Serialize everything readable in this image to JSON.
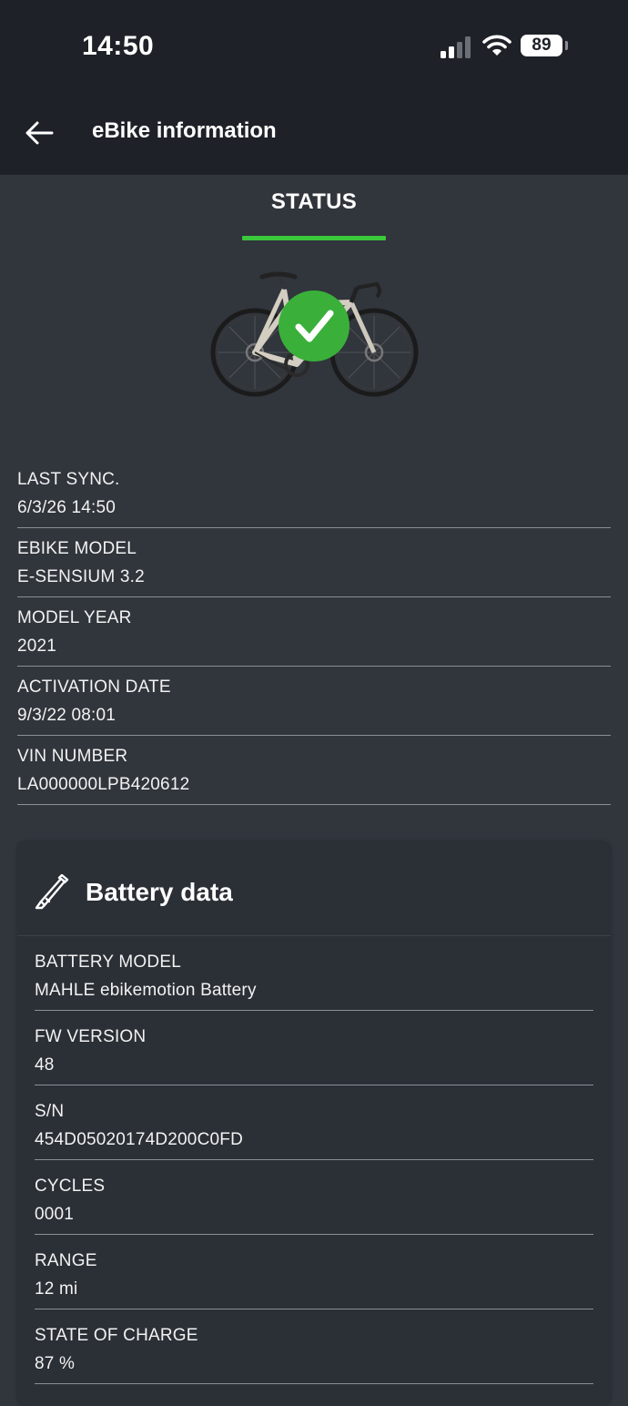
{
  "status_bar": {
    "time": "14:50",
    "battery_level": "89",
    "icons": [
      "cellular-signal-icon",
      "wifi-icon",
      "battery-icon"
    ]
  },
  "app_bar": {
    "title": "eBike information",
    "back_icon": "arrow-left-icon"
  },
  "tabs": [
    {
      "label": "STATUS",
      "selected": true
    }
  ],
  "colors": {
    "accent": "#3cc83c",
    "badge": "#3ab03a",
    "background": "#31353c",
    "header": "#1e2128",
    "card": "#2b2f36"
  },
  "bike": {
    "image_icon": "road-bike-illustration",
    "status_icon": "check-circle-icon"
  },
  "info": [
    {
      "label": "LAST SYNC.",
      "value": "6/3/26 14:50"
    },
    {
      "label": "EBIKE MODEL",
      "value": "E-SENSIUM 3.2"
    },
    {
      "label": "MODEL YEAR",
      "value": "2021"
    },
    {
      "label": "ACTIVATION DATE",
      "value": "9/3/22 08:01"
    },
    {
      "label": "VIN NUMBER",
      "value": "LA000000LPB420612"
    }
  ],
  "battery_card": {
    "title": "Battery data",
    "icon": "battery-tube-icon",
    "rows": [
      {
        "label": "BATTERY MODEL",
        "value": "MAHLE ebikemotion Battery"
      },
      {
        "label": "FW VERSION",
        "value": "48"
      },
      {
        "label": "S/N",
        "value": "454D05020174D200C0FD"
      },
      {
        "label": "CYCLES",
        "value": "0001"
      },
      {
        "label": "RANGE",
        "value": "12 mi"
      },
      {
        "label": "STATE OF CHARGE",
        "value": "87 %"
      }
    ]
  }
}
